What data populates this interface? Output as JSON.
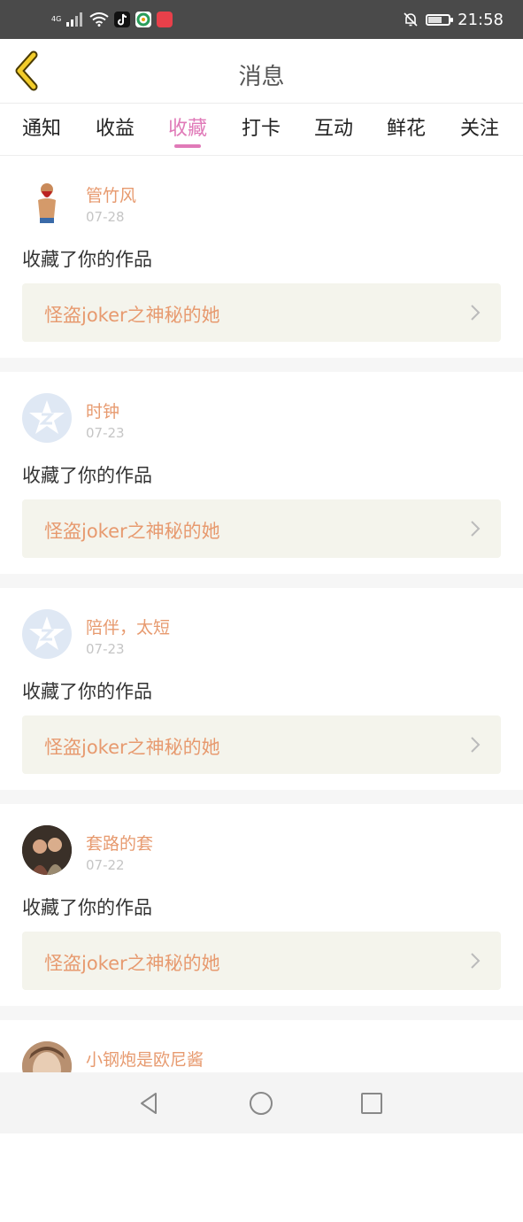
{
  "status_bar": {
    "network": "4G",
    "time": "21:58",
    "icons": [
      "signal-icon",
      "wifi-icon",
      "tiktok-icon",
      "browser-icon",
      "app-icon",
      "bell-muted-icon",
      "battery-icon"
    ]
  },
  "header": {
    "title": "消息",
    "back_icon": "chevron-left-icon",
    "accent_color": "#e8c000"
  },
  "tabs": [
    {
      "label": "通知",
      "active": false
    },
    {
      "label": "收益",
      "active": false
    },
    {
      "label": "收藏",
      "active": true
    },
    {
      "label": "打卡",
      "active": false
    },
    {
      "label": "互动",
      "active": false
    },
    {
      "label": "鲜花",
      "active": false
    },
    {
      "label": "关注",
      "active": false
    }
  ],
  "messages": [
    {
      "user": "管竹风",
      "date": "07-28",
      "action": "收藏了你的作品",
      "work": "怪盗joker之神秘的她",
      "avatar": "photo-red-beard"
    },
    {
      "user": "时钟",
      "date": "07-23",
      "action": "收藏了你的作品",
      "work": "怪盗joker之神秘的她",
      "avatar": "default-qq-icon"
    },
    {
      "user": "陪伴，太短",
      "date": "07-23",
      "action": "收藏了你的作品",
      "work": "怪盗joker之神秘的她",
      "avatar": "default-qq-icon"
    },
    {
      "user": "套路的套",
      "date": "07-22",
      "action": "收藏了你的作品",
      "work": "怪盗joker之神秘的她",
      "avatar": "photo-couple"
    },
    {
      "user": "小钢炮是欧尼酱",
      "date": "",
      "action": "",
      "work": "",
      "avatar": "photo-face"
    }
  ],
  "colors": {
    "accent_tab": "#e07ab8",
    "username": "#e79a6f",
    "work_box": "#f4f4ec"
  }
}
